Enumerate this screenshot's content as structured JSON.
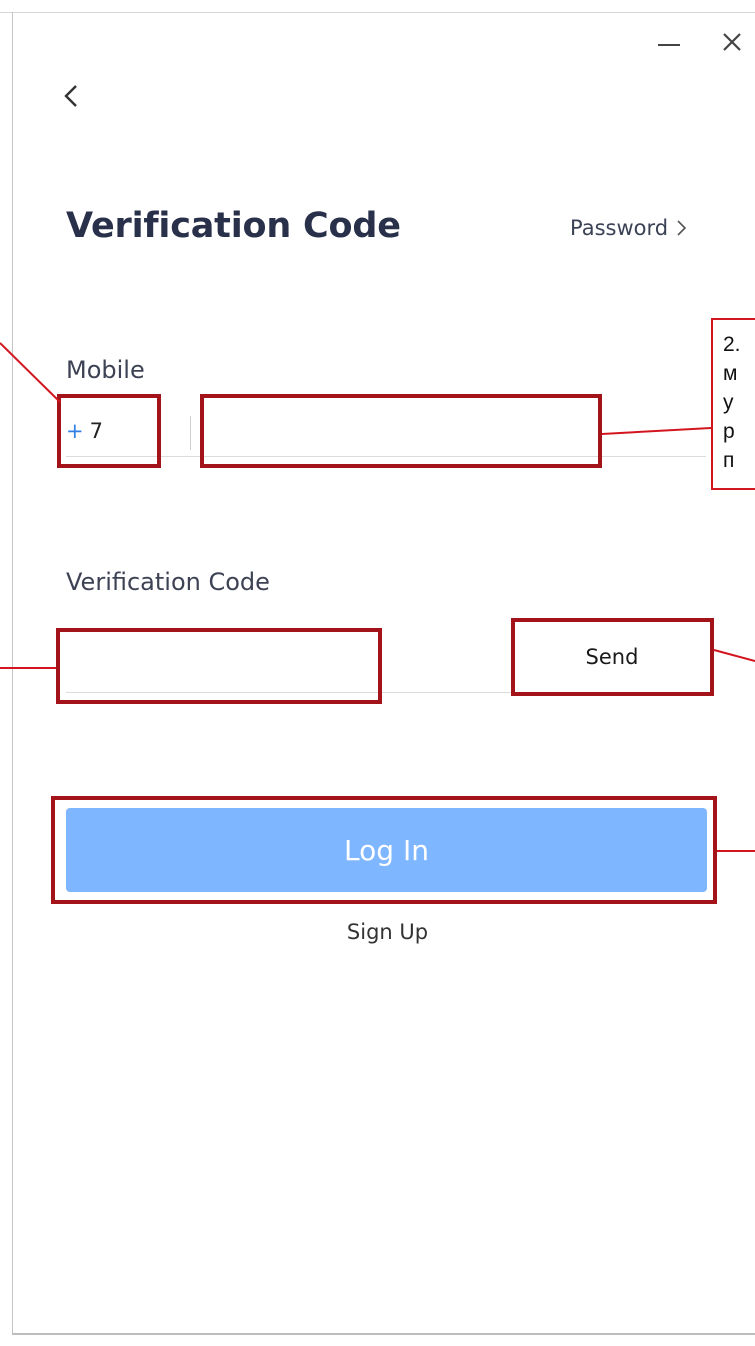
{
  "window": {
    "minimize_icon": "minimize-icon",
    "close_icon": "close-icon",
    "back_icon": "chevron-left-icon"
  },
  "header": {
    "title": "Verification Code",
    "password_link": "Password"
  },
  "form": {
    "mobile_label": "Mobile",
    "country_code_plus": "+",
    "country_code_value": "7",
    "phone_value": "",
    "code_label": "Verification Code",
    "code_value": "",
    "send_label": "Send"
  },
  "actions": {
    "login_label": "Log In",
    "signup_label": "Sign Up"
  },
  "annotation": {
    "note_lines": [
      "2.",
      "м",
      "у",
      "р",
      "п"
    ],
    "color": "#a5131a"
  },
  "colors": {
    "accent": "#7eb6ff",
    "title": "#28304a",
    "plus": "#2f7fe6"
  }
}
